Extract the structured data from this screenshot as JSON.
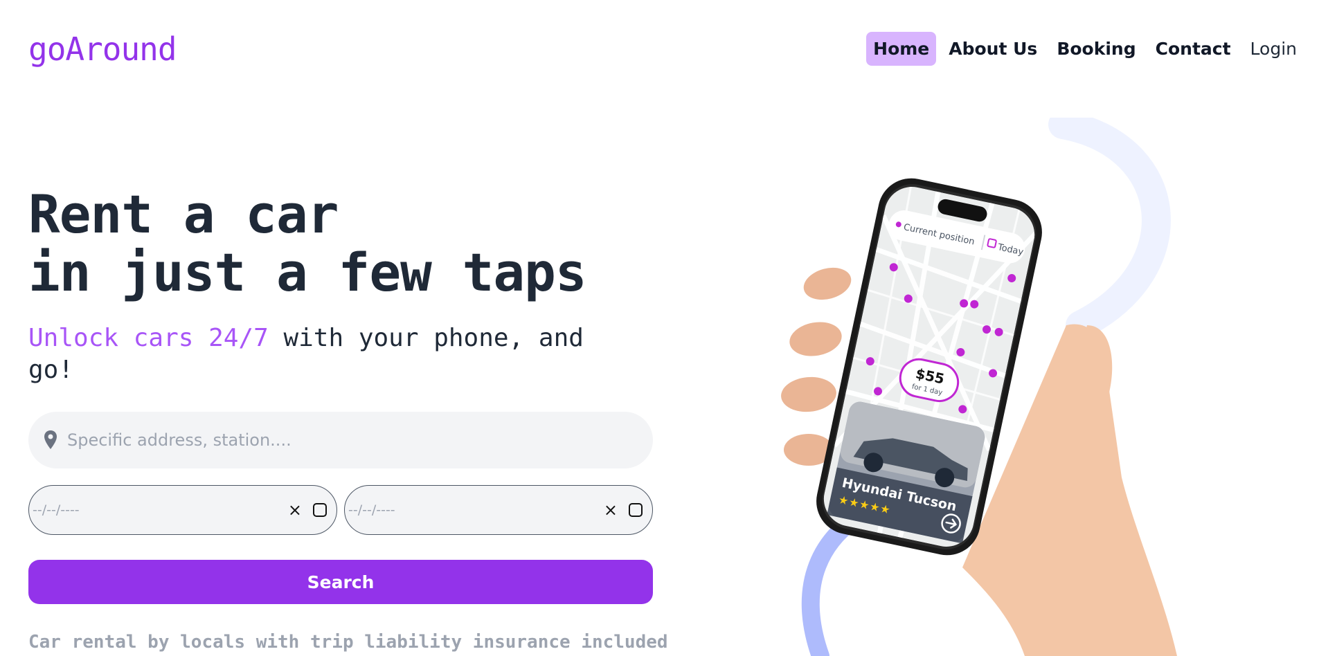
{
  "brand": {
    "logo": "goAround"
  },
  "nav": {
    "items": [
      {
        "label": "Home",
        "active": true
      },
      {
        "label": "About Us"
      },
      {
        "label": "Booking"
      },
      {
        "label": "Contact"
      },
      {
        "label": "Login"
      }
    ]
  },
  "hero": {
    "title_line1": "Rent a car",
    "title_line2": "in just a few taps",
    "subtitle_accent": "Unlock cars 24/7",
    "subtitle_rest": " with your phone, and go!"
  },
  "form": {
    "address_placeholder": "Specific address, station....",
    "start_date": "--/--/----",
    "end_date": "--/--/----",
    "clear_icon": "×",
    "search_label": "Search"
  },
  "footnote": "Car rental by locals with trip liability insurance included",
  "phone_app": {
    "location_label": "Current position",
    "date_label": "Today",
    "price": "$55",
    "price_caption": "for 1 day",
    "car_name": "Hyundai Tucson",
    "rating_stars": 5
  },
  "colors": {
    "accent": "#9333ea",
    "accent_light": "#d8b4fe",
    "pin": "#c026d3"
  }
}
